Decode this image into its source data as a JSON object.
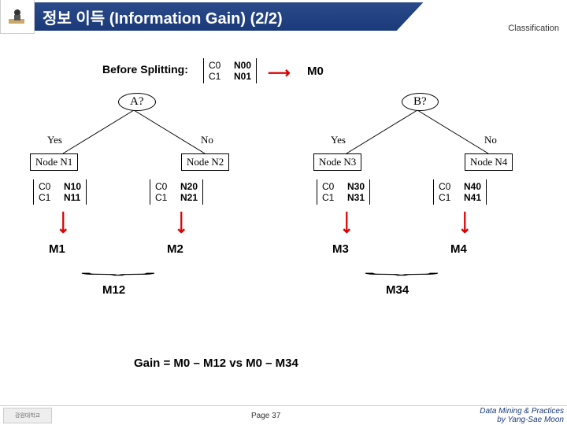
{
  "header": {
    "title": "정보 이득 (Information Gain) (2/2)",
    "classification": "Classification"
  },
  "before_label": "Before Splitting:",
  "root_table": {
    "rows": [
      [
        "C0",
        "N00"
      ],
      [
        "C1",
        "N01"
      ]
    ]
  },
  "root_m": "M0",
  "trees": {
    "left": {
      "question": "A?",
      "yes": "Yes",
      "no": "No",
      "node_left": "Node N1",
      "node_right": "Node N2",
      "table_left": {
        "rows": [
          [
            "C0",
            "N10"
          ],
          [
            "C1",
            "N11"
          ]
        ]
      },
      "table_right": {
        "rows": [
          [
            "C0",
            "N20"
          ],
          [
            "C1",
            "N21"
          ]
        ]
      },
      "m_left": "M1",
      "m_right": "M2",
      "m_combined": "M12"
    },
    "right": {
      "question": "B?",
      "yes": "Yes",
      "no": "No",
      "node_left": "Node N3",
      "node_right": "Node N4",
      "table_left": {
        "rows": [
          [
            "C0",
            "N30"
          ],
          [
            "C1",
            "N31"
          ]
        ]
      },
      "table_right": {
        "rows": [
          [
            "C0",
            "N40"
          ],
          [
            "C1",
            "N41"
          ]
        ]
      },
      "m_left": "M3",
      "m_right": "M4",
      "m_combined": "M34"
    }
  },
  "gain_formula": "Gain = M0 – M12 vs  M0 – M34",
  "footer": {
    "page": "Page 37",
    "course": "Data Mining & Practices",
    "author": "by Yang-Sae Moon",
    "logo": "강원대학교"
  }
}
